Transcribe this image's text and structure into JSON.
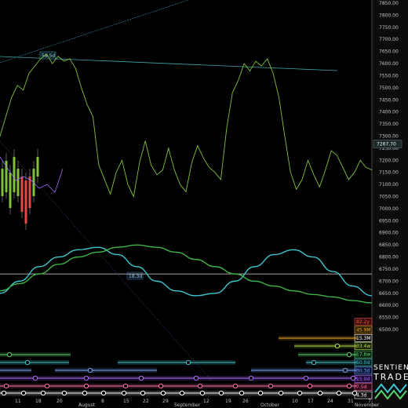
{
  "chart_data": {
    "type": "line",
    "y_ticks": [
      "7850.00",
      "7800.00",
      "7750.00",
      "7700.00",
      "7650.00",
      "7600.00",
      "7550.00",
      "7500.00",
      "7450.00",
      "7400.00",
      "7350.00",
      "7300.00",
      "7250.00",
      "7200.00",
      "7150.00",
      "7100.00",
      "7050.00",
      "7000.00",
      "6950.00",
      "6900.00",
      "6850.00",
      "6800.00",
      "6750.00",
      "6700.00",
      "6650.00",
      "6600.00",
      "6550.00",
      "6500.00"
    ],
    "x_ticks": [
      "11",
      "18",
      "20",
      "August",
      "8",
      "15",
      "22",
      "29",
      "September",
      "12",
      "19",
      "26",
      "October",
      "10",
      "17",
      "24",
      "31",
      "November",
      "7"
    ],
    "current_price": "7267.70",
    "ylim": [
      6500,
      7850
    ],
    "price_series": {
      "color": "#7fc23a",
      "x_index": [
        0,
        1,
        2,
        3,
        4,
        5,
        6,
        7,
        8,
        9,
        10,
        11,
        12,
        13,
        14,
        15,
        16,
        17,
        18,
        19,
        20,
        21,
        22,
        23,
        24,
        25,
        26,
        27,
        28,
        29,
        30,
        31,
        32,
        33,
        34,
        35,
        36,
        37,
        38,
        39,
        40,
        41,
        42,
        43,
        44,
        45,
        46,
        47,
        48,
        49,
        50,
        51,
        52,
        53,
        54,
        55,
        56,
        57,
        58,
        59,
        60,
        61,
        62,
        63,
        64
      ],
      "values": [
        7300,
        7380,
        7460,
        7510,
        7490,
        7560,
        7590,
        7620,
        7640,
        7600,
        7630,
        7610,
        7620,
        7580,
        7500,
        7430,
        7380,
        7180,
        7120,
        7060,
        7150,
        7200,
        7100,
        7050,
        7190,
        7280,
        7180,
        7140,
        7160,
        7250,
        7160,
        7100,
        7070,
        7190,
        7260,
        7210,
        7170,
        7150,
        7120,
        7330,
        7480,
        7530,
        7600,
        7570,
        7610,
        7590,
        7620,
        7560,
        7460,
        7300,
        7150,
        7080,
        7120,
        7200,
        7140,
        7090,
        7160,
        7240,
        7220,
        7170,
        7120,
        7150,
        7200,
        7170,
        7160
      ]
    },
    "cycles": [
      {
        "name": "teal-cycle",
        "color": "#3fc6cf",
        "values": [
          6650,
          6700,
          6760,
          6800,
          6830,
          6840,
          6810,
          6760,
          6700,
          6660,
          6640,
          6650,
          6700,
          6760,
          6810,
          6830,
          6800,
          6740,
          6680,
          6640
        ]
      },
      {
        "name": "green-cycle",
        "color": "#3fb34a",
        "values": [
          6660,
          6690,
          6730,
          6770,
          6800,
          6820,
          6840,
          6850,
          6840,
          6820,
          6790,
          6760,
          6730,
          6700,
          6680,
          6660,
          6645,
          6635,
          6620,
          6610
        ]
      }
    ],
    "horizontal_level": 6730,
    "annotations": {
      "top_label": "58.5d",
      "mid_label": "18.3d"
    },
    "period_tags": [
      {
        "label": "82.2y",
        "color": "#e8503a",
        "bg": "#3a0f0f"
      },
      {
        "label": "45.9M",
        "color": "#f5a623",
        "bg": "#2a2008"
      },
      {
        "label": "15.3M",
        "color": "#ffffff",
        "bg": "#111111"
      },
      {
        "label": "33.4w",
        "color": "#b8e04a",
        "bg": "#1a2208"
      },
      {
        "label": "17.6w",
        "color": "#5bd26b",
        "bg": "#0a2010"
      },
      {
        "label": "50.0d",
        "color": "#3fc6cf",
        "bg": "#082022"
      },
      {
        "label": "30.3d",
        "color": "#7aa8ff",
        "bg": "#0a1430"
      },
      {
        "label": "15.0d",
        "color": "#b06cff",
        "bg": "#1c0a30"
      },
      {
        "label": "7.5d",
        "color": "#ff6fa8",
        "bg": "#2c0a1a"
      },
      {
        "label": "4.3d",
        "color": "#ffffff",
        "bg": "#111111"
      }
    ]
  },
  "logo": {
    "line1": "SENTIENT",
    "line2": "TRADER"
  }
}
